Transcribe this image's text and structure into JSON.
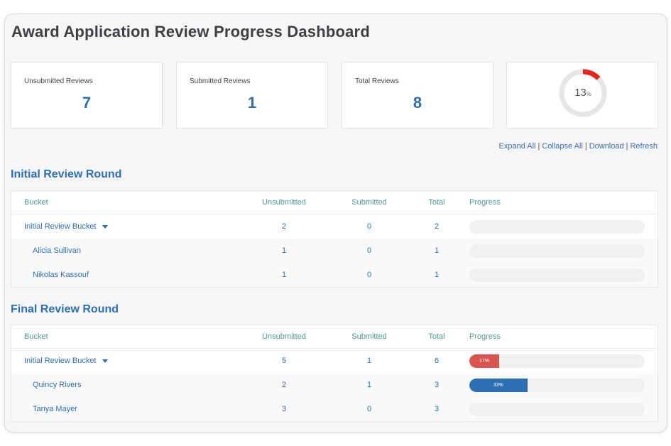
{
  "title": "Award Application Review Progress Dashboard",
  "stats": {
    "unsubmitted": {
      "label": "Unsubmitted Reviews",
      "value": "7"
    },
    "submitted": {
      "label": "Submitted Reviews",
      "value": "1"
    },
    "total": {
      "label": "Total Reviews",
      "value": "8"
    },
    "progress": {
      "value": "13",
      "unit": "%",
      "fraction": 0.13,
      "color": "#e8211a",
      "track_color": "#e6e6e6"
    }
  },
  "links": {
    "expand": "Expand All",
    "collapse": "Collapse All",
    "download": "Download",
    "refresh": "Refresh",
    "sep": "|"
  },
  "columns": {
    "bucket": "Bucket",
    "unsubmitted": "Unsubmitted",
    "submitted": "Submitted",
    "total": "Total",
    "progress": "Progress"
  },
  "initial_round": {
    "title": "Initial Review Round",
    "rows": [
      {
        "name": "Initial Review Bucket",
        "unsubmitted": "2",
        "submitted": "0",
        "total": "2",
        "progress": 0
      },
      {
        "name": "Alicia Sullivan",
        "unsubmitted": "1",
        "submitted": "0",
        "total": "1",
        "progress": 0
      },
      {
        "name": "Nikolas Kassouf",
        "unsubmitted": "1",
        "submitted": "0",
        "total": "1",
        "progress": 0
      }
    ]
  },
  "final_round": {
    "title": "Final Review Round",
    "rows": [
      {
        "name": "Initial Review Bucket",
        "unsubmitted": "5",
        "submitted": "1",
        "total": "6",
        "progress": 0.17,
        "progress_label": "17%",
        "bar_color": "#d9534f"
      },
      {
        "name": "Quincy Rivers",
        "unsubmitted": "2",
        "submitted": "1",
        "total": "3",
        "progress": 0.33,
        "progress_label": "33%",
        "bar_color": "#2c6fb6"
      },
      {
        "name": "Tanya Mayer",
        "unsubmitted": "3",
        "submitted": "0",
        "total": "3",
        "progress": 0
      }
    ]
  }
}
